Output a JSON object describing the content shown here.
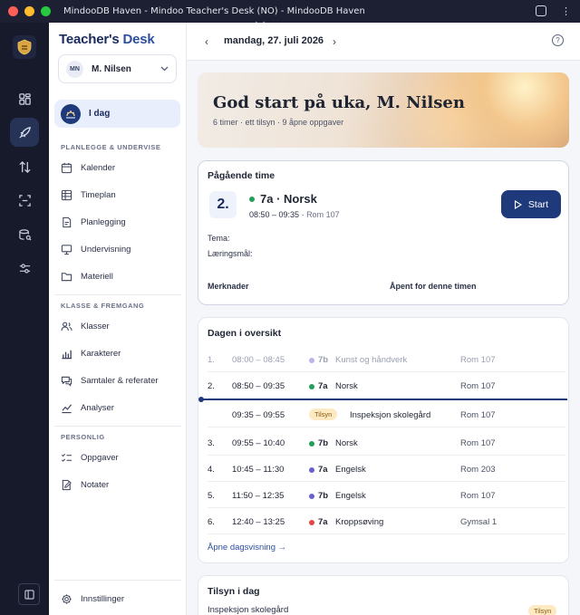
{
  "window": {
    "title": "MindooDB Haven - Mindoo Teacher's Desk (NO) - MindooDB Haven"
  },
  "brand": {
    "part1": "Teacher's",
    "part2": "Desk"
  },
  "user": {
    "initials": "MN",
    "name": "M. Nilsen"
  },
  "sidebar": {
    "today": "I dag",
    "sections": [
      {
        "title": "PLANLEGGE & UNDERVISE",
        "items": [
          "Kalender",
          "Timeplan",
          "Planlegging",
          "Undervisning",
          "Materiell"
        ]
      },
      {
        "title": "KLASSE & FREMGANG",
        "items": [
          "Klasser",
          "Karakterer",
          "Samtaler & referater",
          "Analyser"
        ]
      },
      {
        "title": "PERSONLIG",
        "items": [
          "Oppgaver",
          "Notater"
        ]
      }
    ],
    "settings": "Innstillinger"
  },
  "datebar": {
    "date": "mandag, 27. juli 2026"
  },
  "hero": {
    "title": "God start på uka, M. Nilsen",
    "subtitle": "6 timer · ett tilsyn · 9 åpne oppgaver"
  },
  "current_lesson": {
    "heading": "Pågående time",
    "period": "2.",
    "class": "7a",
    "separator": " · ",
    "subject": "Norsk",
    "class_color": "#22a05a",
    "time": "08:50 – 09:35",
    "room": "Rom 107",
    "start_label": "Start",
    "topic_label": "Tema:",
    "goal_label": "Læringsmål:",
    "notes_label": "Merknader",
    "open_label": "Åpent for denne timen"
  },
  "overview": {
    "heading": "Dagen i oversikt",
    "rows": [
      {
        "num": "1.",
        "time": "08:00 – 08:45",
        "cls": "7b",
        "color": "#b9b4ea",
        "subject": "Kunst og håndverk",
        "room": "Rom 107",
        "past": true
      },
      {
        "num": "2.",
        "time": "08:50 – 09:35",
        "cls": "7a",
        "color": "#22a05a",
        "subject": "Norsk",
        "room": "Rom 107",
        "past": false
      },
      {
        "num": "",
        "time": "09:35 – 09:55",
        "badge": "Tilsyn",
        "subject": "Inspeksjon skolegård",
        "room": "Rom 107",
        "past": false
      },
      {
        "num": "3.",
        "time": "09:55 – 10:40",
        "cls": "7b",
        "color": "#22a05a",
        "subject": "Norsk",
        "room": "Rom 107",
        "past": false
      },
      {
        "num": "4.",
        "time": "10:45 – 11:30",
        "cls": "7a",
        "color": "#6a5fd0",
        "subject": "Engelsk",
        "room": "Rom 203",
        "past": false
      },
      {
        "num": "5.",
        "time": "11:50 – 12:35",
        "cls": "7b",
        "color": "#6a5fd0",
        "subject": "Engelsk",
        "room": "Rom 107",
        "past": false
      },
      {
        "num": "6.",
        "time": "12:40 – 13:25",
        "cls": "7a",
        "color": "#e04848",
        "subject": "Kroppsøving",
        "room": "Gymsal 1",
        "past": false
      }
    ],
    "link": "Åpne dagsvisning →"
  },
  "supervision": {
    "heading": "Tilsyn i dag",
    "item": "Inspeksjon skolegård",
    "badge": "Tilsyn"
  },
  "icons": {
    "rail": [
      "dashboard-icon",
      "rocket-icon",
      "transfer-icon",
      "scan-icon",
      "database-search-icon",
      "sliders-icon"
    ],
    "help": "?"
  }
}
